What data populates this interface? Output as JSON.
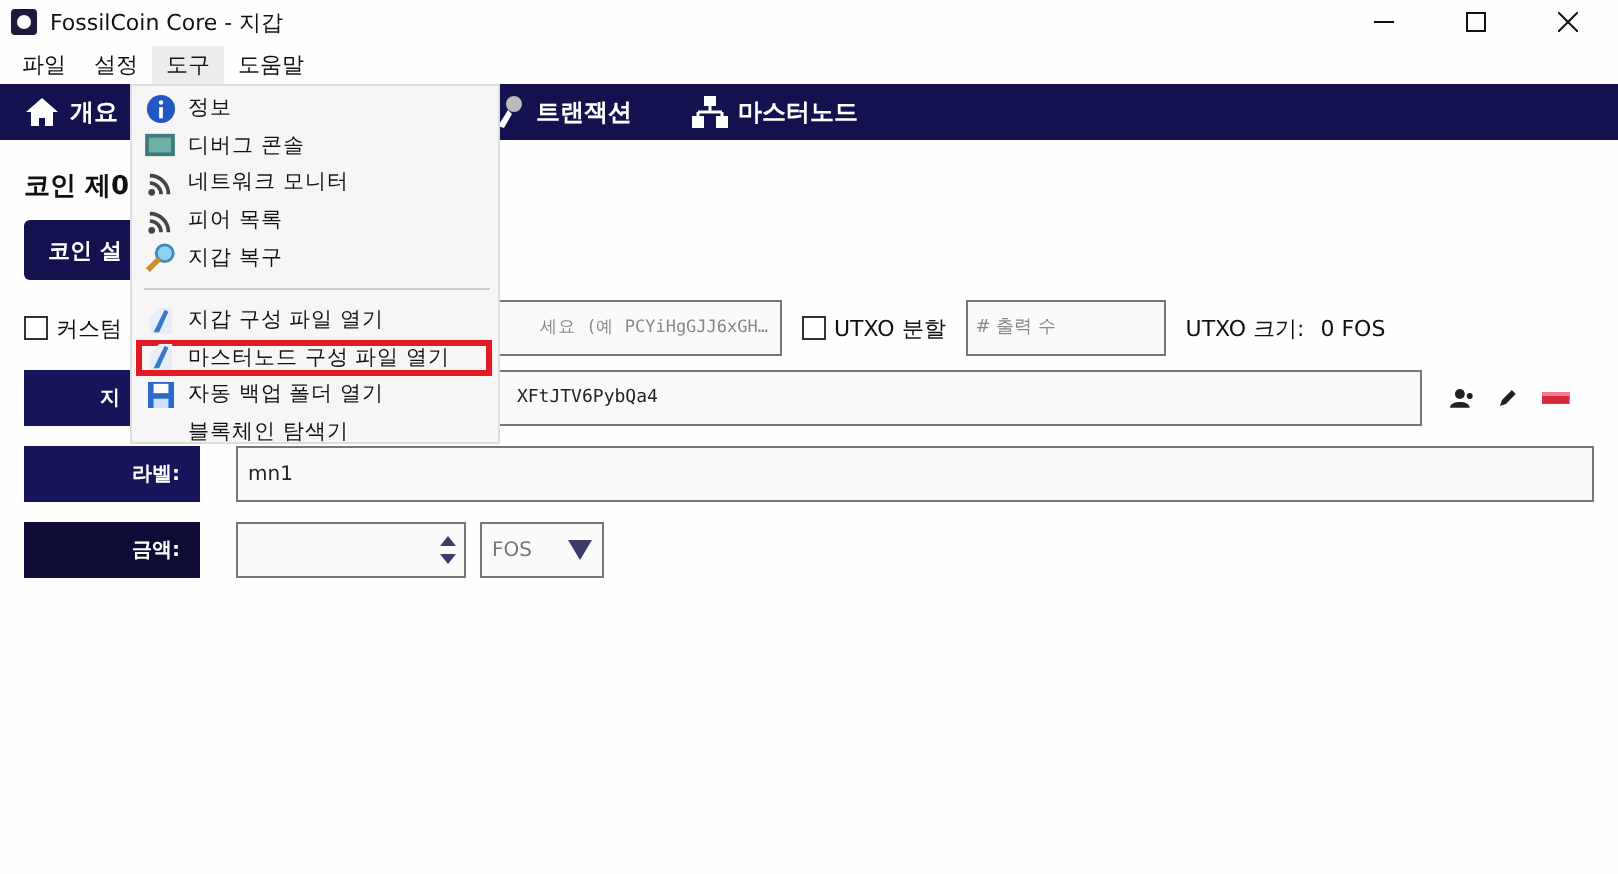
{
  "window": {
    "title": "FossilCoin Core - 지갑"
  },
  "menubar": [
    {
      "label": "파일",
      "selected": false
    },
    {
      "label": "설정",
      "selected": false
    },
    {
      "label": "도구",
      "selected": true
    },
    {
      "label": "도움말",
      "selected": false
    }
  ],
  "navbar": [
    {
      "label": "개요"
    },
    {
      "label": "트랜잭션"
    },
    {
      "label": "마스터노드"
    }
  ],
  "coin_control": {
    "heading": "코인 제0",
    "button": "코인 설"
  },
  "custom_change": {
    "label": "커스텀",
    "checked": false,
    "placeholder": "세요 (예 PCYiHgGJJ6xGH…"
  },
  "utxo_split": {
    "label": "UTXO 분할",
    "checked": false,
    "placeholder": "# 출력 수",
    "size_label": "UTXO 크기:",
    "size_value": "0 FOS"
  },
  "pay_to": {
    "label": "지",
    "value": "XFtJTV6PybQa4"
  },
  "label_row": {
    "label": "라벨:",
    "value": "mn1"
  },
  "amount_row": {
    "label": "금액:",
    "unit": "FOS"
  },
  "tools_menu": [
    {
      "label": "정보",
      "highlighted": false
    },
    {
      "label": "디버그 콘솔",
      "highlighted": false
    },
    {
      "label": "네트워크 모니터",
      "highlighted": false
    },
    {
      "label": "피어 목록",
      "highlighted": false
    },
    {
      "label": "지갑 복구",
      "highlighted": false
    },
    {
      "label": "지갑 구성 파일 열기",
      "highlighted": false,
      "separator_before": true
    },
    {
      "label": "마스터노드 구성 파일 열기",
      "highlighted": true
    },
    {
      "label": "자동 백업 폴더 열기",
      "highlighted": false
    },
    {
      "label": "블록체인 탐색기",
      "highlighted": false
    }
  ]
}
